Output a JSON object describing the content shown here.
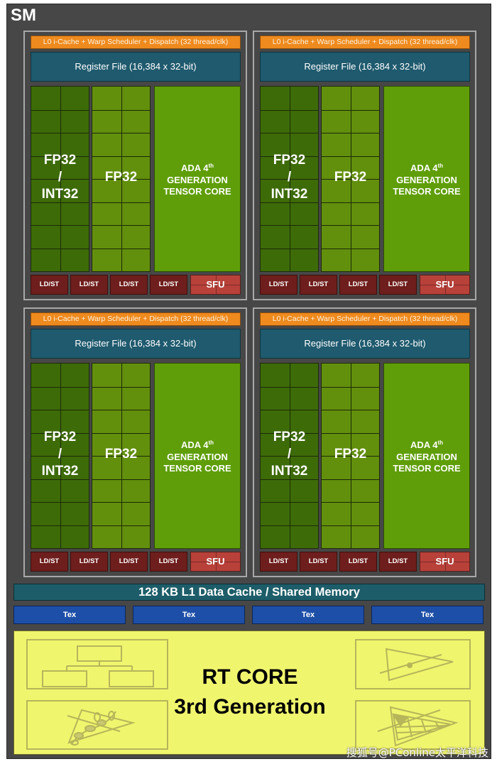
{
  "sm": {
    "title": "SM",
    "partitions": [
      {
        "l0_label": "L0 i-Cache + Warp Scheduler + Dispatch (32 thread/clk)",
        "register_file_label": "Register File (16,384 x 32-bit)",
        "fpint_label": [
          "FP32",
          "/",
          "INT32"
        ],
        "fp32_label": "FP32",
        "tensor_label": [
          "ADA 4",
          "th",
          "GENERATION",
          "TENSOR CORE"
        ],
        "ldst_labels": [
          "LD/ST",
          "LD/ST",
          "LD/ST",
          "LD/ST"
        ],
        "sfu_label": "SFU"
      },
      {
        "l0_label": "L0 i-Cache + Warp Scheduler + Dispatch (32 thread/clk)",
        "register_file_label": "Register File (16,384 x 32-bit)",
        "fpint_label": [
          "FP32",
          "/",
          "INT32"
        ],
        "fp32_label": "FP32",
        "tensor_label": [
          "ADA 4",
          "th",
          "GENERATION",
          "TENSOR CORE"
        ],
        "ldst_labels": [
          "LD/ST",
          "LD/ST",
          "LD/ST",
          "LD/ST"
        ],
        "sfu_label": "SFU"
      },
      {
        "l0_label": "L0 i-Cache + Warp Scheduler + Dispatch (32 thread/clk)",
        "register_file_label": "Register File (16,384 x 32-bit)",
        "fpint_label": [
          "FP32",
          "/",
          "INT32"
        ],
        "fp32_label": "FP32",
        "tensor_label": [
          "ADA 4",
          "th",
          "GENERATION",
          "TENSOR CORE"
        ],
        "ldst_labels": [
          "LD/ST",
          "LD/ST",
          "LD/ST",
          "LD/ST"
        ],
        "sfu_label": "SFU"
      },
      {
        "l0_label": "L0 i-Cache + Warp Scheduler + Dispatch (32 thread/clk)",
        "register_file_label": "Register File (16,384 x 32-bit)",
        "fpint_label": [
          "FP32",
          "/",
          "INT32"
        ],
        "fp32_label": "FP32",
        "tensor_label": [
          "ADA 4",
          "th",
          "GENERATION",
          "TENSOR CORE"
        ],
        "ldst_labels": [
          "LD/ST",
          "LD/ST",
          "LD/ST",
          "LD/ST"
        ],
        "sfu_label": "SFU"
      }
    ],
    "l1_cache_label": "128 KB L1 Data Cache / Shared Memory",
    "tex_labels": [
      "Tex",
      "Tex",
      "Tex",
      "Tex"
    ],
    "rt_core": {
      "line1": "RT CORE",
      "line2": "3rd Generation",
      "icons": [
        "bvh-tree-icon",
        "opacity-micromap-icon",
        "ray-triangle-intersection-icon",
        "displaced-micromesh-icon"
      ]
    }
  },
  "watermark": "搜狐号@PConline太平洋科技",
  "colors": {
    "sm_bg": "#474747",
    "l0": "#ee8a1e",
    "register_file": "#1f5a6e",
    "fp32_int32": "#3d6b08",
    "fp32": "#628f0c",
    "tensor": "#5f9e09",
    "ldst": "#6e1e1c",
    "sfu": "#b8413a",
    "l1": "#1d5d69",
    "tex": "#1d4fa8",
    "rt_core": "#f0f56e"
  }
}
